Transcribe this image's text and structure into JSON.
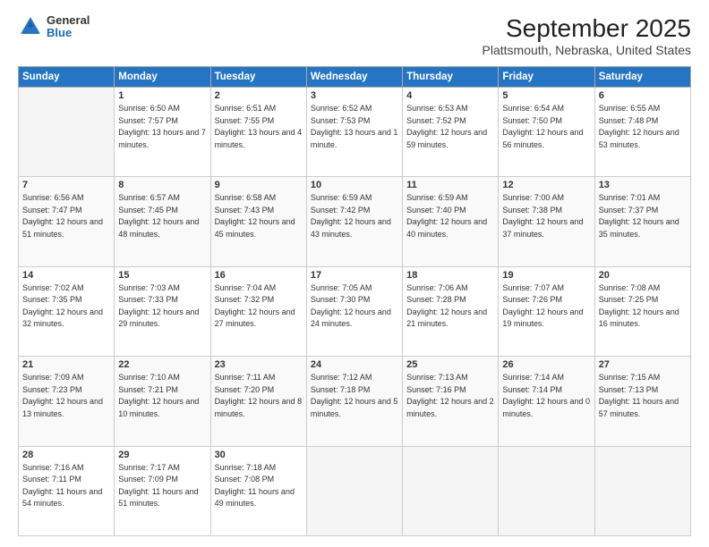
{
  "header": {
    "logo_general": "General",
    "logo_blue": "Blue",
    "title": "September 2025",
    "subtitle": "Plattsmouth, Nebraska, United States"
  },
  "calendar": {
    "days_of_week": [
      "Sunday",
      "Monday",
      "Tuesday",
      "Wednesday",
      "Thursday",
      "Friday",
      "Saturday"
    ],
    "weeks": [
      [
        {
          "day": "",
          "sunrise": "",
          "sunset": "",
          "daylight": ""
        },
        {
          "day": "1",
          "sunrise": "Sunrise: 6:50 AM",
          "sunset": "Sunset: 7:57 PM",
          "daylight": "Daylight: 13 hours and 7 minutes."
        },
        {
          "day": "2",
          "sunrise": "Sunrise: 6:51 AM",
          "sunset": "Sunset: 7:55 PM",
          "daylight": "Daylight: 13 hours and 4 minutes."
        },
        {
          "day": "3",
          "sunrise": "Sunrise: 6:52 AM",
          "sunset": "Sunset: 7:53 PM",
          "daylight": "Daylight: 13 hours and 1 minute."
        },
        {
          "day": "4",
          "sunrise": "Sunrise: 6:53 AM",
          "sunset": "Sunset: 7:52 PM",
          "daylight": "Daylight: 12 hours and 59 minutes."
        },
        {
          "day": "5",
          "sunrise": "Sunrise: 6:54 AM",
          "sunset": "Sunset: 7:50 PM",
          "daylight": "Daylight: 12 hours and 56 minutes."
        },
        {
          "day": "6",
          "sunrise": "Sunrise: 6:55 AM",
          "sunset": "Sunset: 7:48 PM",
          "daylight": "Daylight: 12 hours and 53 minutes."
        }
      ],
      [
        {
          "day": "7",
          "sunrise": "Sunrise: 6:56 AM",
          "sunset": "Sunset: 7:47 PM",
          "daylight": "Daylight: 12 hours and 51 minutes."
        },
        {
          "day": "8",
          "sunrise": "Sunrise: 6:57 AM",
          "sunset": "Sunset: 7:45 PM",
          "daylight": "Daylight: 12 hours and 48 minutes."
        },
        {
          "day": "9",
          "sunrise": "Sunrise: 6:58 AM",
          "sunset": "Sunset: 7:43 PM",
          "daylight": "Daylight: 12 hours and 45 minutes."
        },
        {
          "day": "10",
          "sunrise": "Sunrise: 6:59 AM",
          "sunset": "Sunset: 7:42 PM",
          "daylight": "Daylight: 12 hours and 43 minutes."
        },
        {
          "day": "11",
          "sunrise": "Sunrise: 6:59 AM",
          "sunset": "Sunset: 7:40 PM",
          "daylight": "Daylight: 12 hours and 40 minutes."
        },
        {
          "day": "12",
          "sunrise": "Sunrise: 7:00 AM",
          "sunset": "Sunset: 7:38 PM",
          "daylight": "Daylight: 12 hours and 37 minutes."
        },
        {
          "day": "13",
          "sunrise": "Sunrise: 7:01 AM",
          "sunset": "Sunset: 7:37 PM",
          "daylight": "Daylight: 12 hours and 35 minutes."
        }
      ],
      [
        {
          "day": "14",
          "sunrise": "Sunrise: 7:02 AM",
          "sunset": "Sunset: 7:35 PM",
          "daylight": "Daylight: 12 hours and 32 minutes."
        },
        {
          "day": "15",
          "sunrise": "Sunrise: 7:03 AM",
          "sunset": "Sunset: 7:33 PM",
          "daylight": "Daylight: 12 hours and 29 minutes."
        },
        {
          "day": "16",
          "sunrise": "Sunrise: 7:04 AM",
          "sunset": "Sunset: 7:32 PM",
          "daylight": "Daylight: 12 hours and 27 minutes."
        },
        {
          "day": "17",
          "sunrise": "Sunrise: 7:05 AM",
          "sunset": "Sunset: 7:30 PM",
          "daylight": "Daylight: 12 hours and 24 minutes."
        },
        {
          "day": "18",
          "sunrise": "Sunrise: 7:06 AM",
          "sunset": "Sunset: 7:28 PM",
          "daylight": "Daylight: 12 hours and 21 minutes."
        },
        {
          "day": "19",
          "sunrise": "Sunrise: 7:07 AM",
          "sunset": "Sunset: 7:26 PM",
          "daylight": "Daylight: 12 hours and 19 minutes."
        },
        {
          "day": "20",
          "sunrise": "Sunrise: 7:08 AM",
          "sunset": "Sunset: 7:25 PM",
          "daylight": "Daylight: 12 hours and 16 minutes."
        }
      ],
      [
        {
          "day": "21",
          "sunrise": "Sunrise: 7:09 AM",
          "sunset": "Sunset: 7:23 PM",
          "daylight": "Daylight: 12 hours and 13 minutes."
        },
        {
          "day": "22",
          "sunrise": "Sunrise: 7:10 AM",
          "sunset": "Sunset: 7:21 PM",
          "daylight": "Daylight: 12 hours and 10 minutes."
        },
        {
          "day": "23",
          "sunrise": "Sunrise: 7:11 AM",
          "sunset": "Sunset: 7:20 PM",
          "daylight": "Daylight: 12 hours and 8 minutes."
        },
        {
          "day": "24",
          "sunrise": "Sunrise: 7:12 AM",
          "sunset": "Sunset: 7:18 PM",
          "daylight": "Daylight: 12 hours and 5 minutes."
        },
        {
          "day": "25",
          "sunrise": "Sunrise: 7:13 AM",
          "sunset": "Sunset: 7:16 PM",
          "daylight": "Daylight: 12 hours and 2 minutes."
        },
        {
          "day": "26",
          "sunrise": "Sunrise: 7:14 AM",
          "sunset": "Sunset: 7:14 PM",
          "daylight": "Daylight: 12 hours and 0 minutes."
        },
        {
          "day": "27",
          "sunrise": "Sunrise: 7:15 AM",
          "sunset": "Sunset: 7:13 PM",
          "daylight": "Daylight: 11 hours and 57 minutes."
        }
      ],
      [
        {
          "day": "28",
          "sunrise": "Sunrise: 7:16 AM",
          "sunset": "Sunset: 7:11 PM",
          "daylight": "Daylight: 11 hours and 54 minutes."
        },
        {
          "day": "29",
          "sunrise": "Sunrise: 7:17 AM",
          "sunset": "Sunset: 7:09 PM",
          "daylight": "Daylight: 11 hours and 51 minutes."
        },
        {
          "day": "30",
          "sunrise": "Sunrise: 7:18 AM",
          "sunset": "Sunset: 7:08 PM",
          "daylight": "Daylight: 11 hours and 49 minutes."
        },
        {
          "day": "",
          "sunrise": "",
          "sunset": "",
          "daylight": ""
        },
        {
          "day": "",
          "sunrise": "",
          "sunset": "",
          "daylight": ""
        },
        {
          "day": "",
          "sunrise": "",
          "sunset": "",
          "daylight": ""
        },
        {
          "day": "",
          "sunrise": "",
          "sunset": "",
          "daylight": ""
        }
      ]
    ]
  }
}
